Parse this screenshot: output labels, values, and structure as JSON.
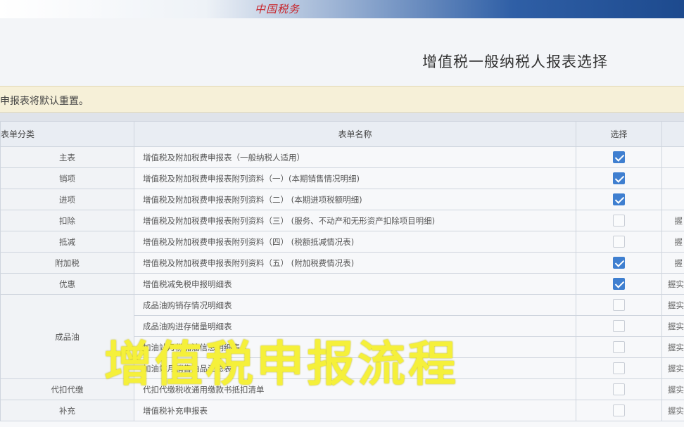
{
  "header": {
    "logo_text": "中国税务",
    "right_text": "-"
  },
  "page": {
    "title": "增值税一般纳税人报表选择"
  },
  "notice": {
    "text": "申报表将默认重置。"
  },
  "table": {
    "headers": {
      "category": "表单分类",
      "name": "表单名称",
      "select": "选择"
    },
    "rows": [
      {
        "category": "主表",
        "name": "增值税及附加税费申报表（一般纳税人适用）",
        "checked": true,
        "extra": ""
      },
      {
        "category": "销项",
        "name": "增值税及附加税费申报表附列资料（一）(本期销售情况明细)",
        "checked": true,
        "extra": ""
      },
      {
        "category": "进项",
        "name": "增值税及附加税费申报表附列资料（二） (本期进项税额明细)",
        "checked": true,
        "extra": ""
      },
      {
        "category": "扣除",
        "name": "增值税及附加税费申报表附列资料（三） (服务、不动产和无形资产扣除项目明细)",
        "checked": false,
        "extra": "握"
      },
      {
        "category": "抵减",
        "name": "增值税及附加税费申报表附列资料（四） (税额抵减情况表)",
        "checked": false,
        "extra": "握"
      },
      {
        "category": "附加税",
        "name": "增值税及附加税费申报表附列资料（五） (附加税费情况表)",
        "checked": true,
        "extra": "握"
      },
      {
        "category": "优惠",
        "name": "增值税减免税申报明细表",
        "checked": true,
        "extra": "握实"
      },
      {
        "category": "成品油",
        "name": "成品油购销存情况明细表",
        "checked": false,
        "extra": "握实"
      },
      {
        "category": "",
        "name": "成品油购进存储量明细表",
        "checked": false,
        "extra": "握实"
      },
      {
        "category": "",
        "name": "加油站月份加油信息明细表",
        "checked": false,
        "extra": "握实"
      },
      {
        "category": "",
        "name": "加油站月销售油品汇总表",
        "checked": false,
        "extra": "握实"
      },
      {
        "category": "代扣代缴",
        "name": "代扣代缴税收通用缴款书抵扣清单",
        "checked": false,
        "extra": "握实"
      },
      {
        "category": "补充",
        "name": "增值税补充申报表",
        "checked": false,
        "extra": "握实"
      }
    ]
  },
  "overlay": {
    "text": "增值税申报流程"
  },
  "colors": {
    "checkbox_checked": "#3f7fd0",
    "overlay_text": "#f5f03a",
    "notice_bg": "#f6f0d8"
  }
}
